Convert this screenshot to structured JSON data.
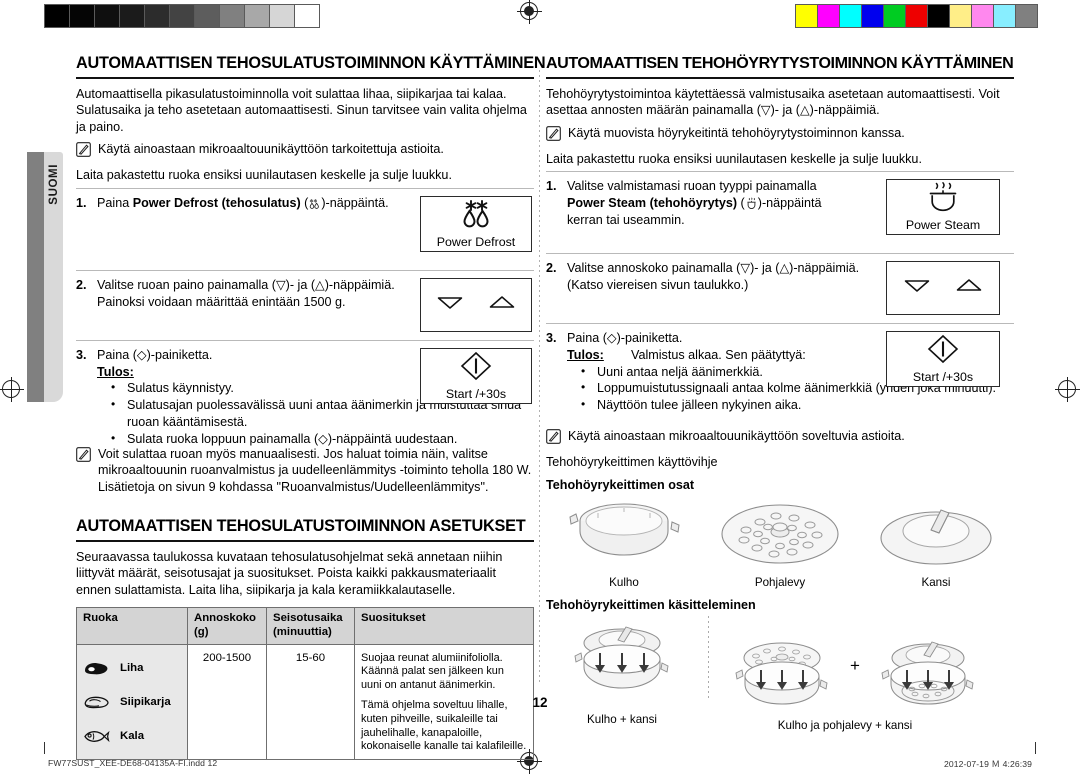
{
  "side_tab": {
    "label": "SUOMI"
  },
  "page_number": "12",
  "footer": {
    "file": "FW77SUST_XEE-DE68-04135A-FI.indd   12",
    "timestamp": "2012-07-19   Ｍ 4:26:39"
  },
  "printer_marks": {
    "gray_wedge": [
      "#000000",
      "#050505",
      "#0f0f0f",
      "#1b1b1b",
      "#2c2c2c",
      "#434343",
      "#5d5d5d",
      "#808080",
      "#a8a8a8",
      "#d6d6d6",
      "#ffffff"
    ],
    "color_bar": [
      "#ffff00",
      "#ff00ff",
      "#00ffff",
      "#0000ee",
      "#00cc22",
      "#ee0000",
      "#000000",
      "#ffee88",
      "#ff88ee",
      "#88eeff",
      "#808080"
    ]
  },
  "left_column": {
    "heading": "AUTOMAATTISEN TEHOSULATUSTOIMINNON KÄYTTÄMINEN",
    "intro": "Automaattisella pikasulatustoiminnolla voit sulattaa lihaa, siipikarjaa tai kalaa. Sulatusaika ja teho asetetaan automaattisesti. Sinun tarvitsee vain valita ohjelma ja paino.",
    "note1": "Käytä ainoastaan mikroaaltouunikäyttöön tarkoitettuja astioita.",
    "pre_step": "Laita pakastettu ruoka ensiksi uunilautasen keskelle ja sulje luukku.",
    "steps": [
      {
        "num": "1.",
        "text_pre": "Paina ",
        "text_bold": "Power Defrost (tehosulatus)",
        "text_post": " ( )-näppäintä.",
        "key_label": "Power Defrost",
        "key_icon": "power-defrost-icon"
      },
      {
        "num": "2.",
        "line1": "Valitse ruoan paino painamalla (▽)- ja (△)-näppäimiä.",
        "line2": "Painoksi voidaan määrittää enintään 1500 g.",
        "key_icon": "up-down-arrows-icon"
      },
      {
        "num": "3.",
        "line1": "Paina (◇)-painiketta.",
        "result_label": "Tulos:",
        "bullets": [
          "Sulatus käynnistyy.",
          "Sulatusajan puolessavälissä uuni antaa äänimerkin ja muistuttaa sinua ruoan kääntämisestä.",
          "Sulata ruoka loppuun painamalla (◇)-näppäintä uudestaan."
        ],
        "key_label": "Start /+30s",
        "key_icon": "start-icon"
      }
    ],
    "note2": "Voit sulattaa ruoan myös manuaalisesti. Jos haluat toimia näin, valitse mikroaaltouunin ruoanvalmistus ja uudelleenlämmitys -toiminto teholla 180 W. Lisätietoja on sivun 9 kohdassa \"Ruoanvalmistus/Uudelleenlämmitys\".",
    "heading2": "AUTOMAATTISEN TEHOSULATUSTOIMINNON ASETUKSET",
    "intro2": "Seuraavassa taulukossa kuvataan tehosulatusohjelmat sekä annetaan niihin liittyvät määrät, seisotusajat ja suositukset. Poista kaikki pakkausmateriaalit ennen sulattamista. Laita liha, siipikarja ja kala keramiikkalautaselle.",
    "table": {
      "headers": [
        "Ruoka",
        "Annoskoko\n(g)",
        "Seisotusaika\n(minuuttia)",
        "Suositukset"
      ],
      "header_cells": [
        {
          "l1": "Ruoka",
          "l2": ""
        },
        {
          "l1": "Annoskoko",
          "l2": "(g)"
        },
        {
          "l1": "Seisotusaika",
          "l2": "(minuuttia)"
        },
        {
          "l1": "Suositukset",
          "l2": ""
        }
      ],
      "foods": [
        {
          "name": "Liha",
          "icon": "meat-icon"
        },
        {
          "name": "Siipikarja",
          "icon": "poultry-icon"
        },
        {
          "name": "Kala",
          "icon": "fish-icon"
        }
      ],
      "portion": "200-1500",
      "standing_time": "15-60",
      "recommendations": [
        "Suojaa reunat alumiinifoliolla. Käännä palat sen jälkeen kun uuni on antanut äänimerkin.",
        "Tämä ohjelma soveltuu lihalle, kuten pihveille, suikaleille tai jauhelihalle, kanapaloille, kokonaiselle kanalle tai kalafileille."
      ]
    }
  },
  "right_column": {
    "heading": "AUTOMAATTISEN TEHOHÖYRYTYSTOIMINNON KÄYTTÄMINEN",
    "intro": "Tehohöyrytystoimintoa käytettäessä valmistusaika asetetaan automaattisesti. Voit asettaa annosten määrän painamalla (▽)- ja (△)-näppäimiä.",
    "note1": "Käytä muovista höyrykeitintä tehohöyrytystoiminnon kanssa.",
    "pre_step": "Laita pakastettu ruoka ensiksi uunilautasen keskelle ja sulje luukku.",
    "steps": [
      {
        "num": "1.",
        "line1": "Valitse valmistamasi ruoan tyyppi painamalla",
        "line2_bold": "Power Steam (tehohöyrytys)",
        "line2_post": " ( )-näppäintä",
        "line3": "kerran tai useammin.",
        "key_label": "Power Steam",
        "key_icon": "power-steam-icon"
      },
      {
        "num": "2.",
        "line1": "Valitse annoskoko painamalla (▽)- ja (△)-näppäimiä.",
        "line2": "(Katso viereisen sivun taulukko.)",
        "key_icon": "up-down-arrows-icon"
      },
      {
        "num": "3.",
        "line1": "Paina (◇)-painiketta.",
        "result_label": "Tulos:",
        "result_intro": "Valmistus alkaa. Sen päätyttyä:",
        "bullets": [
          "Uuni antaa neljä äänimerkkiä.",
          "Loppumuistutussignaali antaa kolme äänimerkkiä (yhden joka minuutti).",
          "Näyttöön tulee jälleen nykyinen aika."
        ],
        "key_label": "Start /+30s",
        "key_icon": "start-icon"
      }
    ],
    "note2": "Käytä ainoastaan mikroaaltouunikäyttöön soveltuvia astioita.",
    "tip_line": "Tehohöyrykeittimen käyttövihje",
    "parts_heading": "Tehohöyrykeittimen osat",
    "parts": [
      {
        "caption": "Kulho",
        "icon": "bowl-icon"
      },
      {
        "caption": "Pohjalevy",
        "icon": "base-plate-icon"
      },
      {
        "caption": "Kansi",
        "icon": "lid-icon"
      }
    ],
    "usage_heading": "Tehohöyrykeittimen käsitteleminen",
    "usage": [
      {
        "caption": "Kulho + kansi",
        "icon": "bowl-lid-assembly-icon"
      },
      {
        "caption": "Kulho ja pohjalevy + kansi",
        "icon": "bowl-plate-lid-assembly-icon"
      }
    ],
    "plus": "+"
  }
}
